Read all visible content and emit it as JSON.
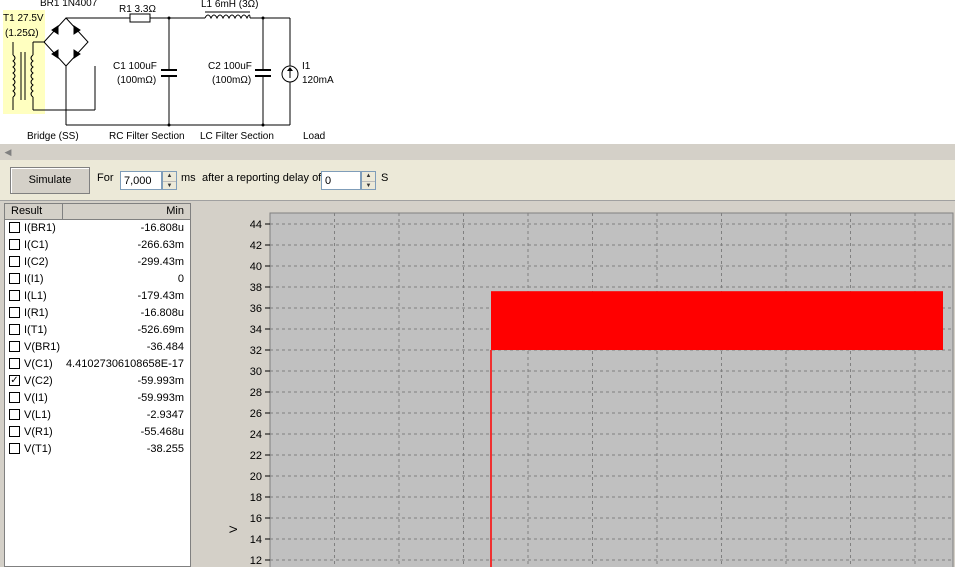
{
  "schematic": {
    "bridge_label": "BR1 1N4007",
    "r1_label": "R1 3.3Ω",
    "l1_label": "L1 6mH (3Ω)",
    "t1_label_1": "T1 27.5V",
    "t1_label_2": "(1.25Ω)",
    "c1_label_1": "C1 100uF",
    "c1_label_2": "(100mΩ)",
    "c2_label_1": "C2 100uF",
    "c2_label_2": "(100mΩ)",
    "i1_label_1": "I1",
    "i1_label_2": "120mA",
    "section_bridge": "Bridge (SS)",
    "section_rc": "RC Filter Section",
    "section_lc": "LC Filter Section",
    "section_load": "Load"
  },
  "toolbar": {
    "simulate_label": "Simulate",
    "for_label": "For",
    "duration_value": "7,000",
    "duration_unit": "ms",
    "delay_label": "after a reporting delay of",
    "delay_value": "0",
    "delay_unit": "S"
  },
  "results": {
    "col_result": "Result",
    "col_min": "Min",
    "rows": [
      {
        "name": "I(BR1)",
        "min": "-16.808u",
        "checked": false
      },
      {
        "name": "I(C1)",
        "min": "-266.63m",
        "checked": false
      },
      {
        "name": "I(C2)",
        "min": "-299.43m",
        "checked": false
      },
      {
        "name": "I(I1)",
        "min": "0",
        "checked": false
      },
      {
        "name": "I(L1)",
        "min": "-179.43m",
        "checked": false
      },
      {
        "name": "I(R1)",
        "min": "-16.808u",
        "checked": false
      },
      {
        "name": "I(T1)",
        "min": "-526.69m",
        "checked": false
      },
      {
        "name": "V(BR1)",
        "min": "-36.484",
        "checked": false
      },
      {
        "name": "V(C1)",
        "min": "4.41027306108658E-17",
        "checked": false
      },
      {
        "name": "V(C2)",
        "min": "-59.993m",
        "checked": true
      },
      {
        "name": "V(I1)",
        "min": "-59.993m",
        "checked": false
      },
      {
        "name": "V(L1)",
        "min": "-2.9347",
        "checked": false
      },
      {
        "name": "V(R1)",
        "min": "-55.468u",
        "checked": false
      },
      {
        "name": "V(T1)",
        "min": "-38.255",
        "checked": false
      }
    ]
  },
  "chart_data": {
    "type": "area",
    "ylabel": "V",
    "y_ticks": [
      12,
      14,
      16,
      18,
      20,
      22,
      24,
      26,
      28,
      30,
      32,
      34,
      36,
      38,
      40,
      42,
      44
    ],
    "ylim": [
      12,
      44
    ],
    "grid": true,
    "series": [
      {
        "color": "#ff0000",
        "ripple_band": [
          32,
          37.6
        ]
      }
    ]
  }
}
